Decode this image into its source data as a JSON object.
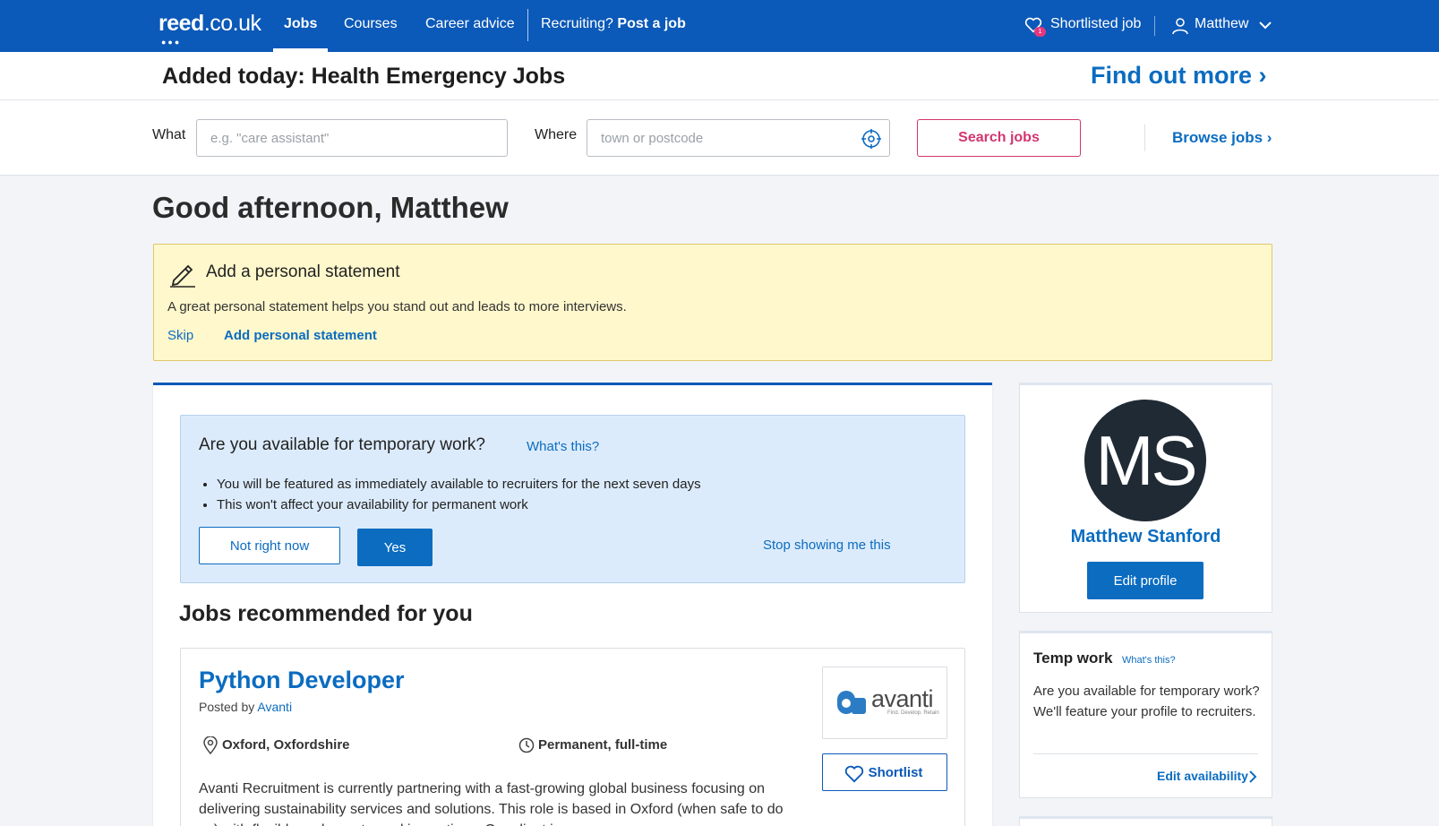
{
  "nav": {
    "logo": "reed",
    "logo_domain": ".co.uk",
    "jobs": "Jobs",
    "courses": "Courses",
    "career_advice": "Career advice",
    "recruiting": "Recruiting?",
    "post_job": "Post a job",
    "shortlisted": "Shortlisted job",
    "shortlisted_count": "1",
    "user_name": "Matthew"
  },
  "promo": {
    "title": "Added today: Health Emergency Jobs",
    "link": "Find out more ›"
  },
  "search": {
    "what_label": "What",
    "what_placeholder": "e.g. \"care assistant\"",
    "where_label": "Where",
    "where_placeholder": "town or postcode",
    "search_button": "Search jobs",
    "browse": "Browse jobs ›"
  },
  "greeting": "Good afternoon, Matthew",
  "statement": {
    "title": "Add a personal statement",
    "description": "A great personal statement helps you stand out and leads to more interviews.",
    "skip": "Skip",
    "add": "Add personal statement"
  },
  "temp": {
    "question": "Are you available for temporary work?",
    "whats_this": "What's this?",
    "bullets": [
      "You will be featured as immediately available to recruiters for the next seven days",
      "This won't affect your availability for permanent work"
    ],
    "not_now": "Not right now",
    "yes": "Yes",
    "stop": "Stop showing me this"
  },
  "recommended": {
    "heading": "Jobs recommended for you",
    "job": {
      "title": "Python Developer",
      "posted_by_prefix": "Posted by ",
      "posted_by": "Avanti",
      "location": "Oxford, Oxfordshire",
      "type": "Permanent, full-time",
      "description": "Avanti Recruitment is currently partnering with a fast-growing global business focusing on delivering sustainability services and solutions. This role is based in Oxford (when safe to do so) with flexible and remote working options. Our client is",
      "logo_text": "avanti",
      "logo_tagline": "Find. Develop. Retain",
      "shortlist": "Shortlist"
    }
  },
  "profile": {
    "initials": "MS",
    "name": "Matthew Stanford",
    "edit": "Edit profile"
  },
  "temp_work": {
    "title": "Temp work",
    "whats_this": "What's this?",
    "description": "Are you available for temporary work? We'll feature your profile to recruiters.",
    "edit": "Edit availability"
  },
  "colors": {
    "brand_blue": "#0b59b8",
    "link_blue": "#0b6cc0",
    "accent_pink": "#d3356f",
    "notice_yellow": "#fff8cc"
  }
}
